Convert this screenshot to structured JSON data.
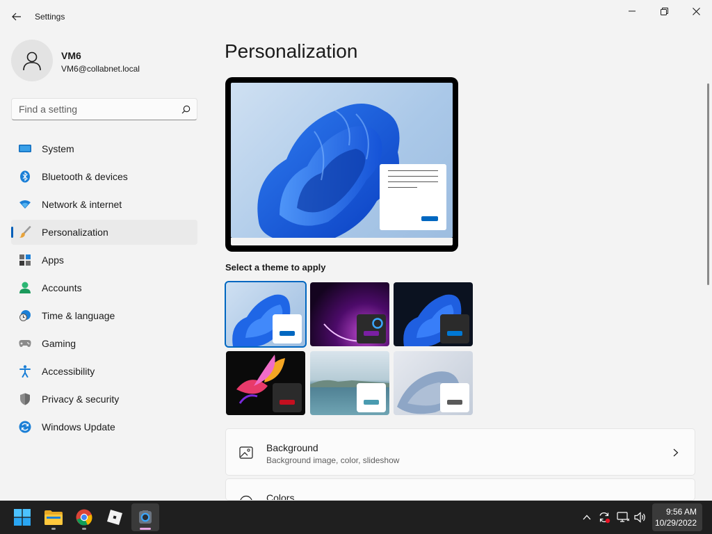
{
  "window": {
    "title": "Settings"
  },
  "user": {
    "name": "VM6",
    "email": "VM6@collabnet.local"
  },
  "search": {
    "placeholder": "Find a setting"
  },
  "sidebar": {
    "items": [
      {
        "label": "System",
        "icon": "monitor-icon"
      },
      {
        "label": "Bluetooth & devices",
        "icon": "bluetooth-icon"
      },
      {
        "label": "Network & internet",
        "icon": "wifi-icon"
      },
      {
        "label": "Personalization",
        "icon": "brush-icon",
        "active": true
      },
      {
        "label": "Apps",
        "icon": "apps-icon"
      },
      {
        "label": "Accounts",
        "icon": "person-icon"
      },
      {
        "label": "Time & language",
        "icon": "clock-globe-icon"
      },
      {
        "label": "Gaming",
        "icon": "gamepad-icon"
      },
      {
        "label": "Accessibility",
        "icon": "accessibility-icon"
      },
      {
        "label": "Privacy & security",
        "icon": "shield-icon"
      },
      {
        "label": "Windows Update",
        "icon": "update-icon"
      }
    ]
  },
  "main": {
    "title": "Personalization",
    "theme_heading": "Select a theme to apply",
    "themes": [
      {
        "id": "windows-light",
        "accent": "#0067c0",
        "selected": true
      },
      {
        "id": "glow",
        "accent": "#7a1fa2"
      },
      {
        "id": "windows-dark",
        "accent": "#0078d4"
      },
      {
        "id": "captured-motion",
        "accent": "#c50f1f"
      },
      {
        "id": "sunrise",
        "accent": "#4a9bb0"
      },
      {
        "id": "flow",
        "accent": "#5a5a5a"
      }
    ],
    "cards": [
      {
        "title": "Background",
        "subtitle": "Background image, color, slideshow",
        "icon": "image-icon"
      },
      {
        "title": "Colors",
        "subtitle": "",
        "icon": "palette-icon"
      }
    ]
  },
  "taskbar": {
    "apps": [
      "start-icon",
      "file-explorer-icon",
      "chrome-icon",
      "roblox-icon",
      "settings-icon"
    ],
    "time": "9:56 AM",
    "date": "10/29/2022"
  },
  "colors": {
    "accent": "#005fb8",
    "background": "#f3f3f3"
  }
}
